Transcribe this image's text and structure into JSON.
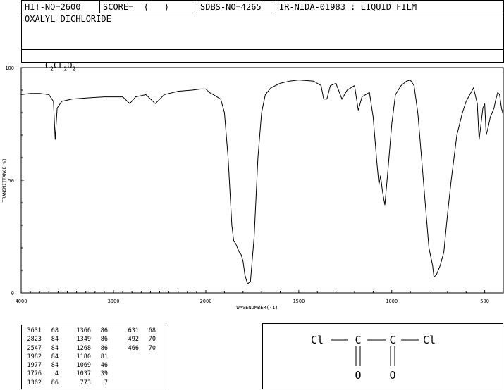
{
  "header": {
    "hit_no": "HIT-NO=2600",
    "score": "SCORE=  (   )",
    "sdbs_no": "SDBS-NO=4265",
    "ir_info": "IR-NIDA-01983 : LIQUID FILM",
    "compound_name": "OXALYL DICHLORIDE",
    "formula": {
      "c": "C",
      "c_sub": "2",
      "cl": "CL",
      "cl_sub": "2",
      "o": "O",
      "o_sub": "2"
    }
  },
  "chart_data": {
    "type": "line",
    "xlabel": "WAVENUMBER(-1)",
    "ylabel": "TRANSMITTANCE(%)",
    "xlim": [
      4000,
      400
    ],
    "ylim": [
      0,
      100
    ],
    "x_reversed": true,
    "x_ticks": [
      4000,
      3000,
      2000,
      1500,
      1000,
      500
    ],
    "x_tick_labels": [
      "4000",
      "3000",
      "2000",
      "1500",
      "1000",
      "500"
    ],
    "y_ticks": [
      0,
      50,
      100
    ],
    "y_tick_labels": [
      "0",
      "50",
      "100"
    ],
    "series": [
      {
        "x": [
          4000,
          3900,
          3800,
          3700,
          3650,
          3631,
          3610,
          3560,
          3450,
          3300,
          3100,
          3000,
          2900,
          2823,
          2760,
          2650,
          2547,
          2450,
          2300,
          2150,
          2050,
          2000,
          1982,
          1960,
          1920,
          1900,
          1880,
          1860,
          1850,
          1840,
          1820,
          1810,
          1800,
          1790,
          1776,
          1760,
          1740,
          1720,
          1700,
          1680,
          1650,
          1600,
          1550,
          1500,
          1420,
          1380,
          1366,
          1349,
          1330,
          1300,
          1268,
          1240,
          1200,
          1180,
          1160,
          1120,
          1100,
          1080,
          1069,
          1060,
          1050,
          1037,
          1020,
          1000,
          980,
          950,
          920,
          900,
          880,
          860,
          840,
          820,
          800,
          780,
          773,
          760,
          740,
          720,
          700,
          680,
          650,
          620,
          600,
          580,
          560,
          540,
          530,
          520,
          510,
          500,
          492,
          480,
          470,
          460,
          450,
          440,
          430,
          420,
          410,
          400
        ],
        "y": [
          88,
          88.5,
          88.5,
          88,
          85,
          68,
          82,
          85,
          86,
          86.5,
          87,
          87,
          87,
          84,
          87,
          88,
          84,
          88,
          89.5,
          90,
          90.5,
          90.5,
          89,
          88,
          86,
          80,
          60,
          30,
          23,
          22,
          18,
          17,
          14,
          8,
          4,
          5,
          25,
          60,
          80,
          88,
          91,
          93,
          94,
          94.5,
          94,
          92,
          86,
          86,
          92,
          93,
          86,
          90,
          92,
          81,
          87,
          89,
          78,
          58,
          48,
          52,
          45,
          39,
          55,
          75,
          88,
          92,
          94,
          94.5,
          92,
          80,
          60,
          40,
          20,
          12,
          7,
          8,
          12,
          18,
          35,
          50,
          70,
          80,
          85,
          88,
          91,
          84,
          68,
          75,
          82,
          84,
          70,
          74,
          78,
          80,
          82,
          86,
          89,
          88,
          82,
          79
        ]
      }
    ],
    "peak_table": [
      {
        "wavenumber": "3631",
        "transmittance": "68"
      },
      {
        "wavenumber": "2823",
        "transmittance": "84"
      },
      {
        "wavenumber": "2547",
        "transmittance": "84"
      },
      {
        "wavenumber": "1982",
        "transmittance": "84"
      },
      {
        "wavenumber": "1977",
        "transmittance": "84"
      },
      {
        "wavenumber": "1776",
        "transmittance": "4"
      },
      {
        "wavenumber": "1362",
        "transmittance": "86"
      },
      {
        "wavenumber": "1366",
        "transmittance": "86"
      },
      {
        "wavenumber": "1349",
        "transmittance": "86"
      },
      {
        "wavenumber": "1268",
        "transmittance": "86"
      },
      {
        "wavenumber": "1180",
        "transmittance": "81"
      },
      {
        "wavenumber": "1069",
        "transmittance": "46"
      },
      {
        "wavenumber": "1037",
        "transmittance": "39"
      },
      {
        "wavenumber": "773",
        "transmittance": "7"
      },
      {
        "wavenumber": "631",
        "transmittance": "68"
      },
      {
        "wavenumber": "492",
        "transmittance": "70"
      },
      {
        "wavenumber": "466",
        "transmittance": "70"
      }
    ]
  },
  "structure": {
    "atoms": [
      "Cl",
      "C",
      "C",
      "Cl",
      "O",
      "O"
    ]
  }
}
